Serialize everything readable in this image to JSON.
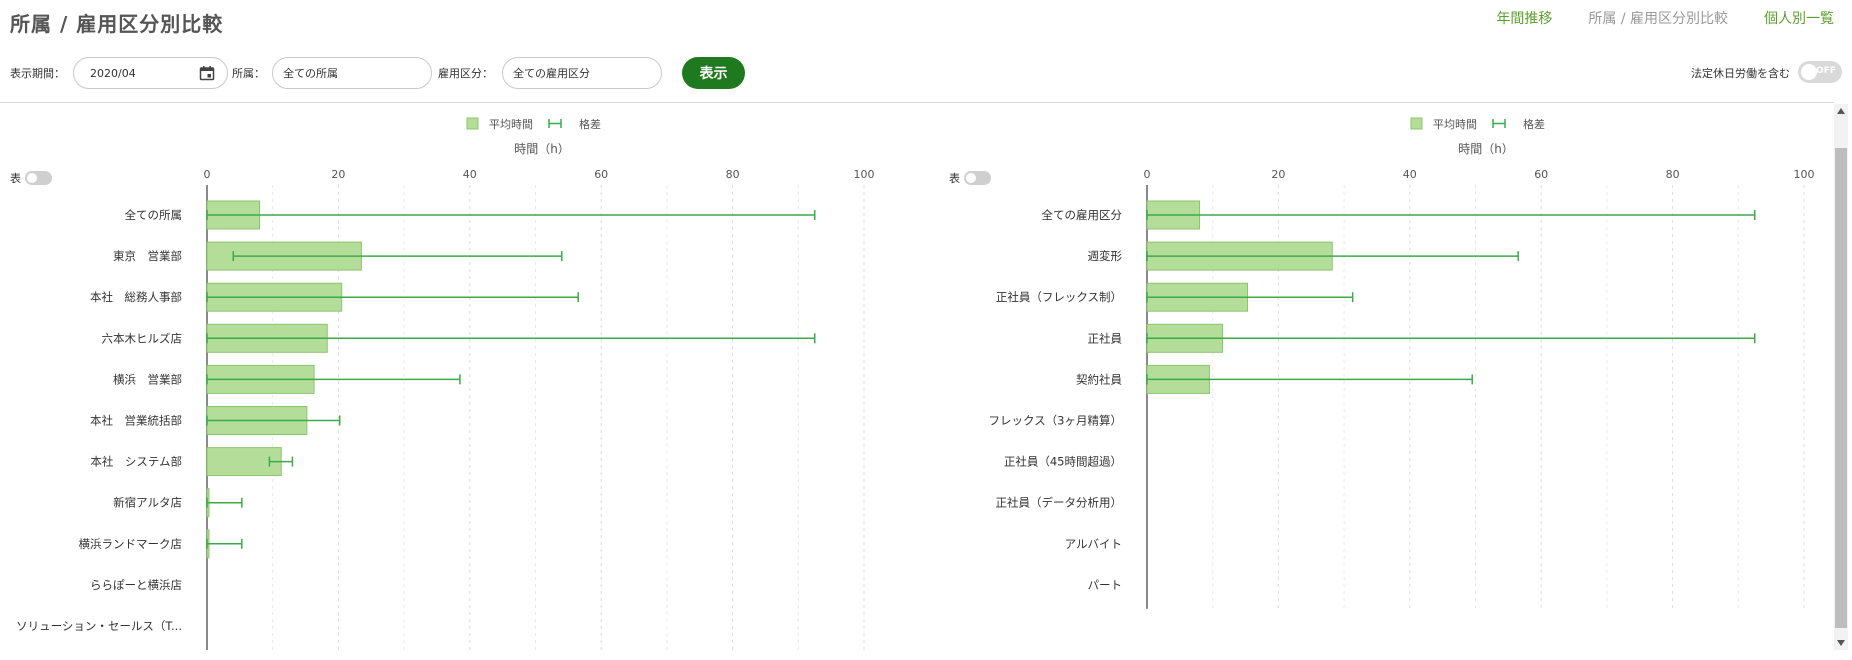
{
  "page": {
    "title": "所属 / 雇用区分別比較"
  },
  "nav": {
    "annual": "年間推移",
    "compare": "所属 / 雇用区分別比較",
    "individual": "個人別一覧"
  },
  "filters": {
    "period_label": "表示期間：",
    "period_value": "2020/04",
    "dept_label": "所属：",
    "dept_value": "全ての所属",
    "emp_label": "雇用区分：",
    "emp_value": "全ての雇用区分",
    "show_button": "表示",
    "holiday_label": "法定休日労働を含む",
    "holiday_toggle": "OFF"
  },
  "table_toggle_label": "表",
  "colors": {
    "bar": "#b5dd9a",
    "bar_border": "#8bc56e",
    "error": "#3daa4a",
    "button": "#1f7a1f",
    "nav": "#5aa02c"
  },
  "chart_data": [
    {
      "type": "bar",
      "orientation": "horizontal",
      "legend": [
        "平均時間",
        "格差"
      ],
      "legend_position": "top",
      "xlabel": "時間（h）",
      "xlim": [
        0,
        100
      ],
      "xticks": [
        "0",
        "20",
        "40",
        "60",
        "80",
        "100"
      ],
      "grid": true,
      "categories": [
        "全ての所属",
        "東京　営業部",
        "本社　総務人事部",
        "六本木ヒルズ店",
        "横浜　営業部",
        "本社　営業統括部",
        "本社　システム部",
        "新宿アルタ店",
        "横浜ランドマーク店",
        "ららぽーと横浜店",
        "ソリューション・セールス（T..."
      ],
      "values": [
        8,
        23.5,
        20.5,
        18.3,
        16.3,
        15.2,
        11.3,
        0.3,
        0.3,
        null,
        null
      ],
      "error_low": [
        0,
        4,
        0,
        0,
        0,
        0,
        9.5,
        0,
        0,
        null,
        null
      ],
      "error_high": [
        92.5,
        54,
        56.5,
        92.5,
        38.5,
        20.2,
        13,
        5.3,
        5.3,
        null,
        null
      ]
    },
    {
      "type": "bar",
      "orientation": "horizontal",
      "legend": [
        "平均時間",
        "格差"
      ],
      "legend_position": "top",
      "xlabel": "時間（h）",
      "xlim": [
        0,
        100
      ],
      "xticks": [
        "0",
        "20",
        "40",
        "60",
        "80",
        "100"
      ],
      "grid": true,
      "categories": [
        "全ての雇用区分",
        "週変形",
        "正社員（フレックス制）",
        "正社員",
        "契約社員",
        "フレックス（3ヶ月精算）",
        "正社員（45時間超過）",
        "正社員（データ分析用）",
        "アルバイト",
        "パート"
      ],
      "values": [
        8,
        28.2,
        15.3,
        11.5,
        9.5,
        null,
        null,
        null,
        null,
        null
      ],
      "error_low": [
        0,
        0,
        0,
        0,
        0,
        null,
        null,
        null,
        null,
        null
      ],
      "error_high": [
        92.5,
        56.5,
        31.3,
        92.5,
        49.5,
        null,
        null,
        null,
        null,
        null
      ]
    }
  ]
}
